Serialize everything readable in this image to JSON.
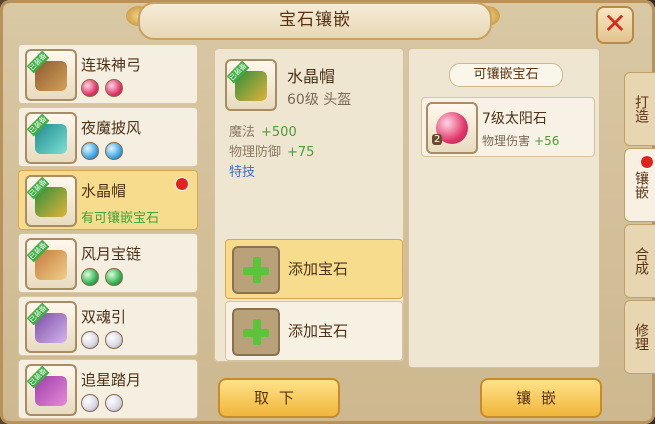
{
  "window": {
    "title": "宝石镶嵌",
    "close_label": "✕"
  },
  "items": [
    {
      "name": "连珠神弓",
      "tag": "已装备",
      "gems": [
        "pink",
        "pink"
      ],
      "note": ""
    },
    {
      "name": "夜魔披风",
      "tag": "已装备",
      "gems": [
        "blue",
        "blue"
      ],
      "note": ""
    },
    {
      "name": "水晶帽",
      "tag": "已装备",
      "gems": [],
      "note": "有可镶嵌宝石",
      "selected": true,
      "alert": true
    },
    {
      "name": "风月宝链",
      "tag": "已装备",
      "gems": [
        "green",
        "green"
      ],
      "note": ""
    },
    {
      "name": "双魂引",
      "tag": "已装备",
      "gems": [
        "white",
        "white"
      ],
      "note": ""
    },
    {
      "name": "追星踏月",
      "tag": "已装备",
      "gems": [
        "white",
        "white"
      ],
      "note": ""
    }
  ],
  "detail": {
    "name": "水晶帽",
    "level_slot": "60级 头盔",
    "stats": [
      {
        "label": "魔法",
        "value": "+500"
      },
      {
        "label": "物理防御",
        "value": "+75"
      }
    ],
    "special": "特技",
    "slots": [
      {
        "label": "添加宝石"
      },
      {
        "label": "添加宝石"
      }
    ]
  },
  "gem_panel": {
    "title": "可镶嵌宝石",
    "gems": [
      {
        "name": "7级太阳石",
        "effect_label": "物理伤害",
        "effect_value": "+56",
        "count": "2"
      }
    ]
  },
  "tabs": [
    {
      "label": "打造"
    },
    {
      "label": "镶嵌",
      "active": true
    },
    {
      "label": "合成"
    },
    {
      "label": "修理"
    }
  ],
  "buttons": {
    "remove": "取下",
    "inlay": "镶嵌"
  }
}
